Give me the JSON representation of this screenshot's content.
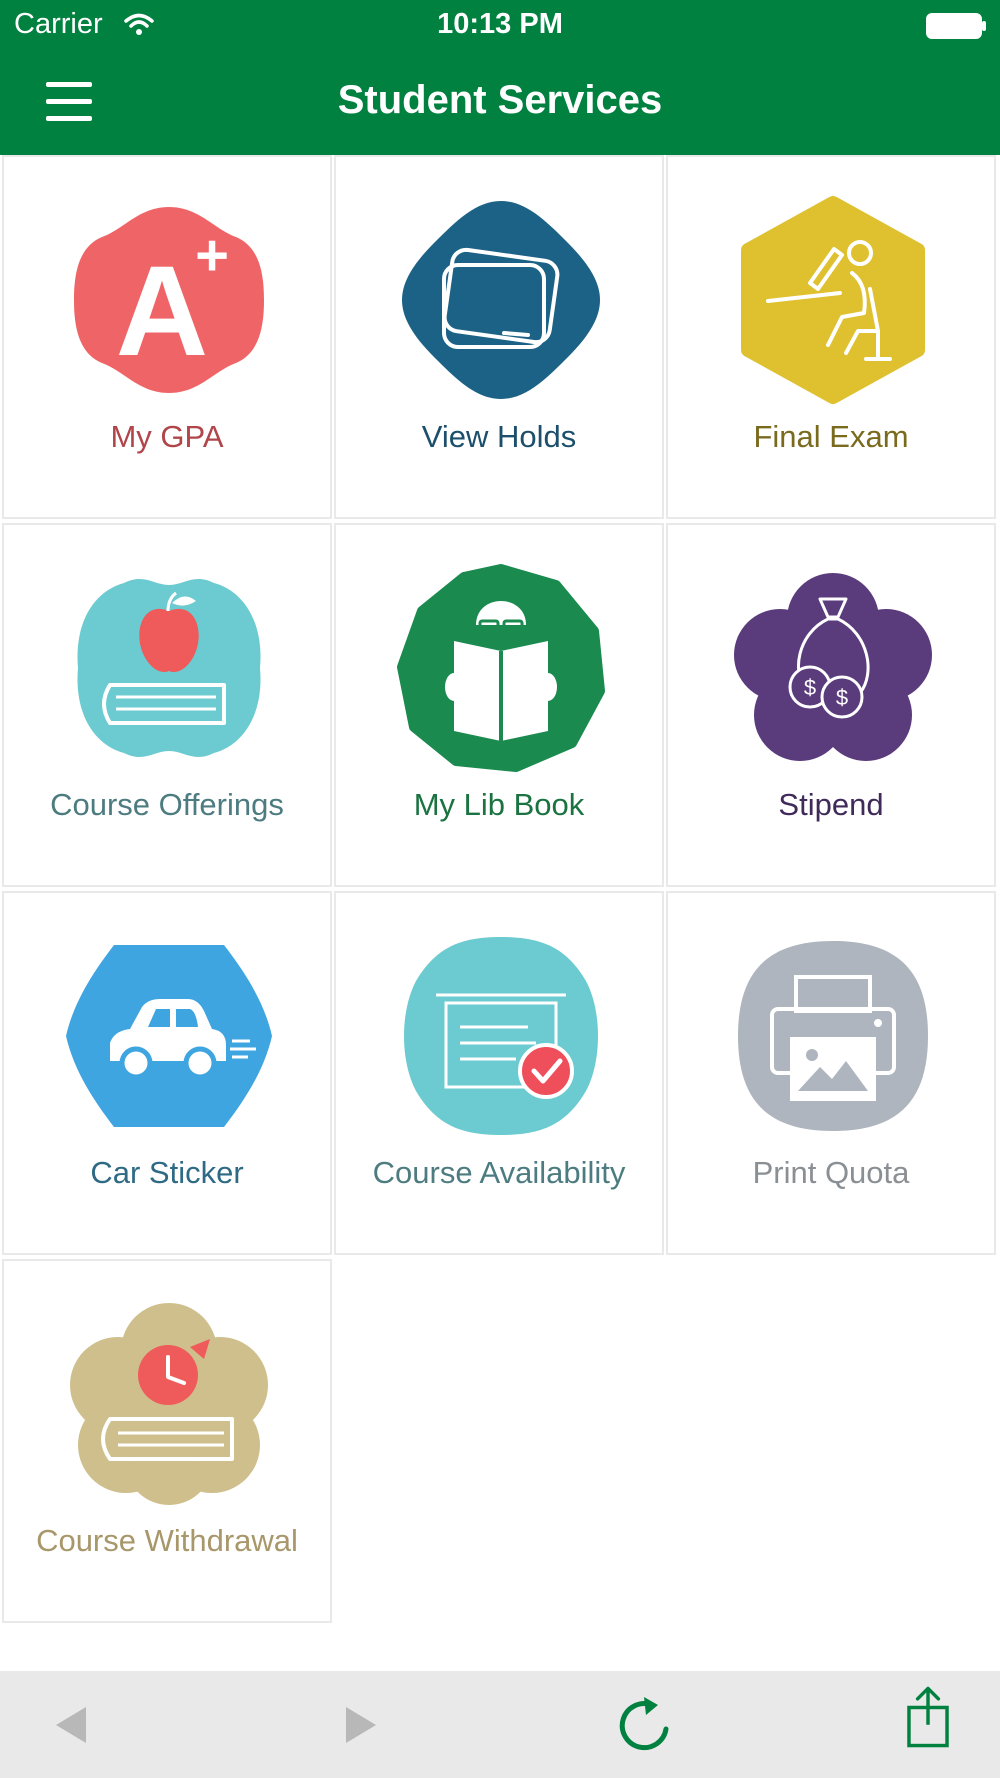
{
  "status_bar": {
    "carrier": "Carrier",
    "time": "10:13 PM"
  },
  "header": {
    "title": "Student Services",
    "menu_icon": "hamburger-menu-icon"
  },
  "colors": {
    "brand": "#018140",
    "toolbar_bg": "#e9e9e9"
  },
  "tiles": [
    {
      "label": "My GPA",
      "icon": "a-plus-grade-icon",
      "color": "#ef6567",
      "text_color": "#b0454a"
    },
    {
      "label": "View Holds",
      "icon": "holds-card-icon",
      "color": "#1c6286",
      "text_color": "#1c4f6c"
    },
    {
      "label": "Final Exam",
      "icon": "exam-desk-icon",
      "color": "#dfc02e",
      "text_color": "#7a6a1e"
    },
    {
      "label": "Course Offerings",
      "icon": "apple-on-book-icon",
      "color": "#6ccbd0",
      "text_color": "#4d7c80"
    },
    {
      "label": "My Lib Book",
      "icon": "reading-person-icon",
      "color": "#1a8a4f",
      "text_color": "#1a7340"
    },
    {
      "label": "Stipend",
      "icon": "money-bag-icon",
      "color": "#5a3b7c",
      "text_color": "#3f2a5a"
    },
    {
      "label": "Car Sticker",
      "icon": "car-icon",
      "color": "#3ea5e0",
      "text_color": "#2f6a85"
    },
    {
      "label": "Course Availability",
      "icon": "course-check-icon",
      "color": "#6ccbd0",
      "text_color": "#4d7c80"
    },
    {
      "label": "Print Quota",
      "icon": "printer-icon",
      "color": "#aeb5be",
      "text_color": "#8a8f94"
    },
    {
      "label": "Course Withdrawal",
      "icon": "clock-on-book-icon",
      "color": "#cfbf8c",
      "text_color": "#a8976a"
    }
  ],
  "toolbar": {
    "back_icon": "back-arrow-icon",
    "forward_icon": "forward-arrow-icon",
    "reload_icon": "reload-icon",
    "share_icon": "share-icon"
  }
}
